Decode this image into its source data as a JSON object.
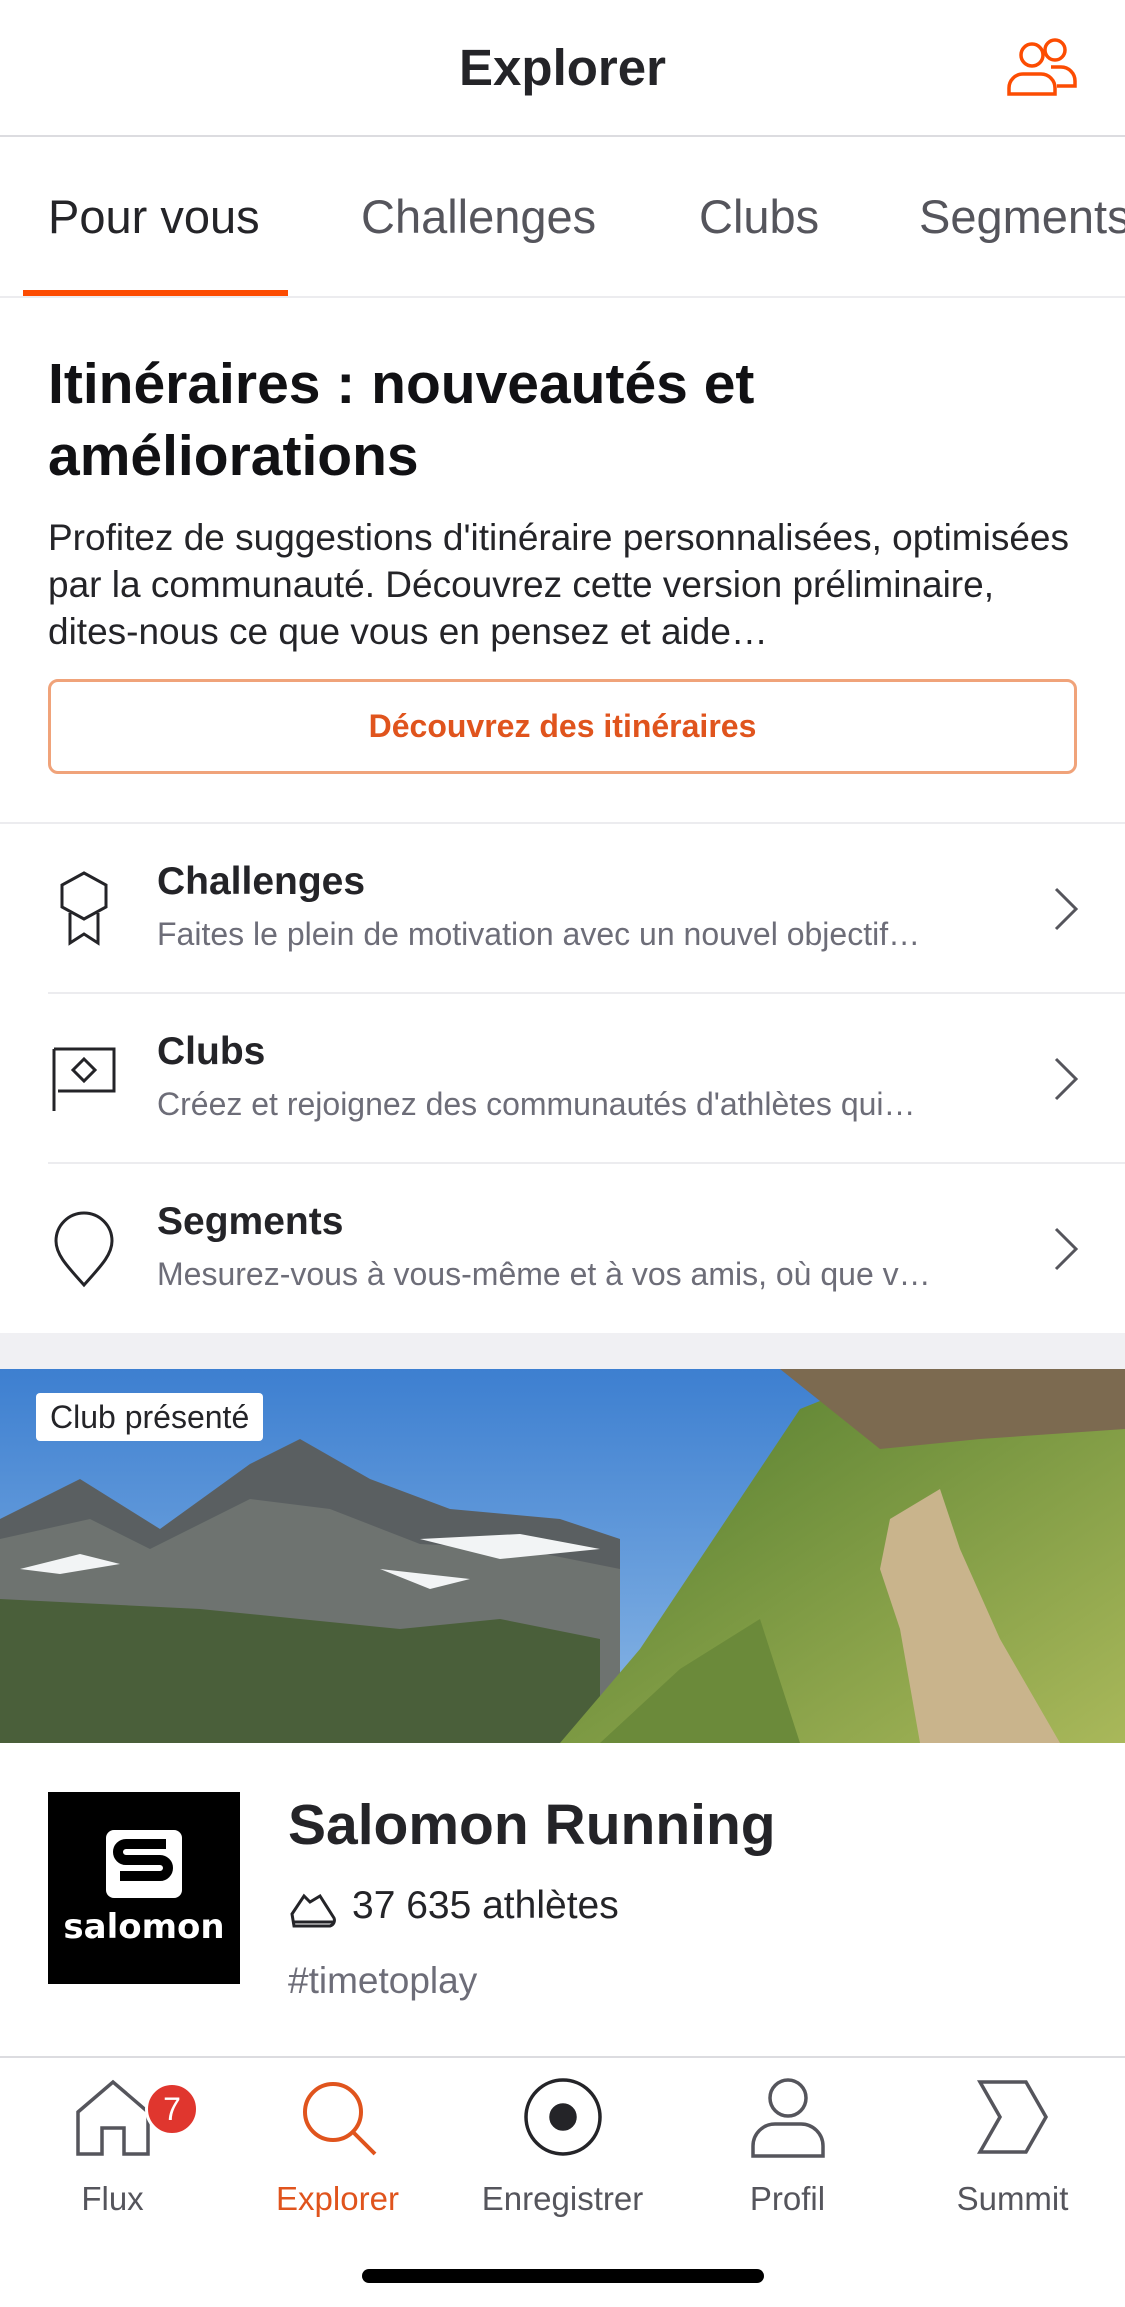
{
  "header": {
    "title": "Explorer",
    "icon": "athletes-group-icon"
  },
  "tabs": [
    {
      "label": "Pour vous",
      "active": true
    },
    {
      "label": "Challenges",
      "active": false
    },
    {
      "label": "Clubs",
      "active": false
    },
    {
      "label": "Segments",
      "active": false
    }
  ],
  "promo": {
    "title": "Itinéraires : nouveautés et améliorations",
    "description": "Profitez de suggestions d'itinéraire personnalisées, optimisées par la communauté. Découvrez cette version préliminaire, dites-nous ce que vous en pensez et aide…",
    "button_label": "Découvrez des itinéraires"
  },
  "list": [
    {
      "title": "Challenges",
      "subtitle": "Faites le plein de motivation avec un nouvel objectif…",
      "icon": "badge-icon"
    },
    {
      "title": "Clubs",
      "subtitle": "Créez et rejoignez des communautés d'athlètes qui…",
      "icon": "flag-icon"
    },
    {
      "title": "Segments",
      "subtitle": "Mesurez-vous à vous-même et à vos amis, où que v…",
      "icon": "location-pin-icon"
    }
  ],
  "featured_club": {
    "badge": "Club présenté",
    "name": "Salomon Running",
    "members": "37 635 athlètes",
    "hashtag": "#timetoplay",
    "logo_text": "salomon"
  },
  "bottom_nav": [
    {
      "label": "Flux",
      "icon": "home-icon",
      "badge": "7",
      "active": false
    },
    {
      "label": "Explorer",
      "icon": "search-icon",
      "badge": null,
      "active": true
    },
    {
      "label": "Enregistrer",
      "icon": "record-icon",
      "badge": null,
      "active": false
    },
    {
      "label": "Profil",
      "icon": "profile-icon",
      "badge": null,
      "active": false
    },
    {
      "label": "Summit",
      "icon": "summit-icon",
      "badge": null,
      "active": false
    }
  ],
  "colors": {
    "accent": "#fc4c02",
    "accent_text": "#e0541d",
    "badge": "#e0362e",
    "text_primary": "#242428",
    "text_secondary": "#6d6d78"
  }
}
